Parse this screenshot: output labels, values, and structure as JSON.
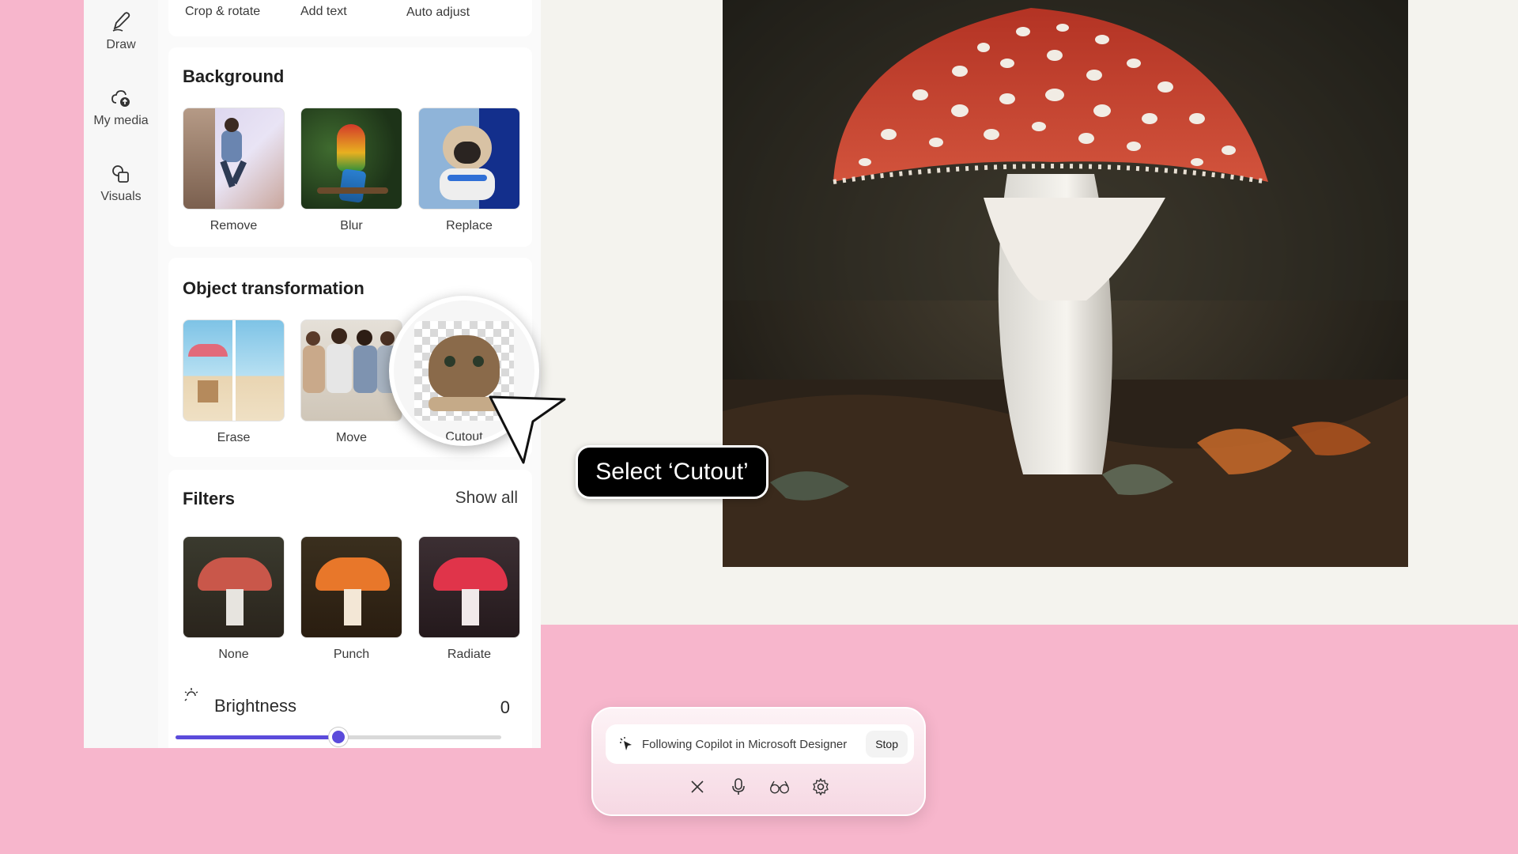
{
  "rail": {
    "items": [
      {
        "label": "Draw",
        "icon": "pen-icon"
      },
      {
        "label": "My media",
        "icon": "cloud-upload-icon"
      },
      {
        "label": "Visuals",
        "icon": "shapes-icon"
      }
    ]
  },
  "top_tools": {
    "crop": "Crop & rotate",
    "text": "Add text",
    "auto": "Auto adjust"
  },
  "background": {
    "title": "Background",
    "tools": [
      "Remove",
      "Blur",
      "Replace"
    ]
  },
  "object_transformation": {
    "title": "Object transformation",
    "tools": [
      "Erase",
      "Move",
      "Cutout"
    ]
  },
  "filters": {
    "title": "Filters",
    "show_all": "Show all",
    "tools": [
      "None",
      "Punch",
      "Radiate"
    ]
  },
  "brightness": {
    "label": "Brightness",
    "value": "0",
    "slider_fraction": 0.5
  },
  "tooltip": "Select ‘Cutout’",
  "copilot": {
    "status": "Following Copilot in Microsoft Designer",
    "stop": "Stop"
  },
  "colors": {
    "background": "#f7b6cc",
    "accent": "#5b4bdb",
    "tooltip_bg": "#000000"
  }
}
